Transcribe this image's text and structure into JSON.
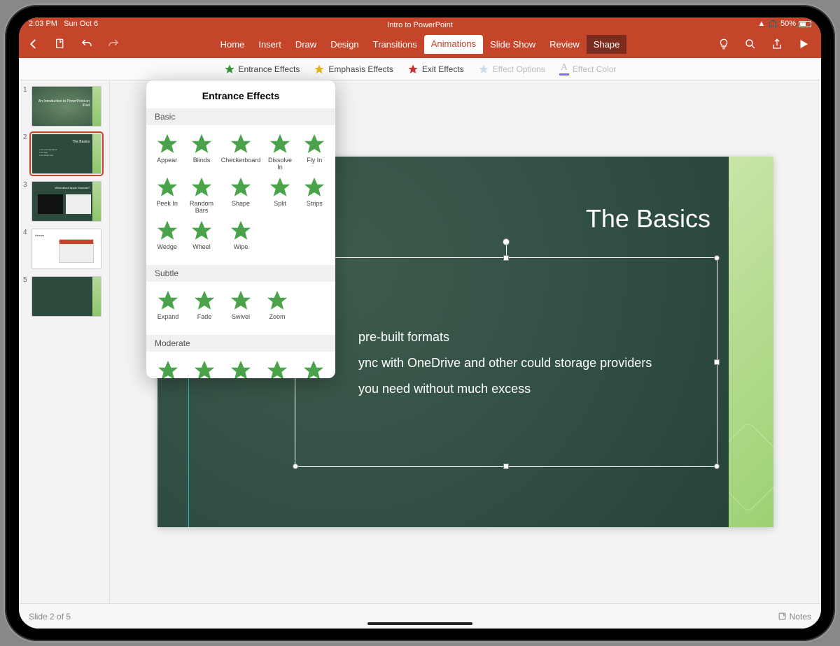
{
  "status": {
    "time": "2:03 PM",
    "date": "Sun Oct 6",
    "battery": "50%"
  },
  "document": {
    "title": "Intro to PowerPoint"
  },
  "ribbon_tabs": [
    {
      "label": "Home",
      "key": "home"
    },
    {
      "label": "Insert",
      "key": "insert"
    },
    {
      "label": "Draw",
      "key": "draw"
    },
    {
      "label": "Design",
      "key": "design"
    },
    {
      "label": "Transitions",
      "key": "transitions"
    },
    {
      "label": "Animations",
      "key": "animations",
      "active": true
    },
    {
      "label": "Slide Show",
      "key": "slideshow"
    },
    {
      "label": "Review",
      "key": "review"
    },
    {
      "label": "Shape",
      "key": "shape",
      "contextual": true
    }
  ],
  "sub_ribbon": {
    "entrance": "Entrance Effects",
    "emphasis": "Emphasis Effects",
    "exit": "Exit Effects",
    "options": "Effect Options",
    "color": "Effect Color"
  },
  "thumbnails": [
    {
      "num": "1",
      "title": "An Introduction to PowerPoint on iPad"
    },
    {
      "num": "2",
      "title": "The Basics",
      "selected": true
    },
    {
      "num": "3",
      "title": "What about Apple Keynote?"
    },
    {
      "num": "4",
      "title": ""
    },
    {
      "num": "5",
      "title": ""
    }
  ],
  "slide": {
    "title": "The Basics",
    "bullets": [
      "pre-built formats",
      "ync with OneDrive and other could storage providers",
      "you need without much excess"
    ]
  },
  "popover": {
    "title": "Entrance Effects",
    "sections": [
      {
        "name": "Basic",
        "items": [
          "Appear",
          "Blinds",
          "Checkerboard",
          "Dissolve In",
          "Fly In",
          "Peek In",
          "Random Bars",
          "Shape",
          "Split",
          "Strips",
          "Wedge",
          "Wheel",
          "Wipe"
        ]
      },
      {
        "name": "Subtle",
        "items": [
          "Expand",
          "Fade",
          "Swivel",
          "Zoom"
        ]
      },
      {
        "name": "Moderate",
        "items": [
          "",
          "",
          "",
          "",
          ""
        ]
      }
    ]
  },
  "footer": {
    "counter": "Slide 2 of 5",
    "notes": "Notes"
  }
}
